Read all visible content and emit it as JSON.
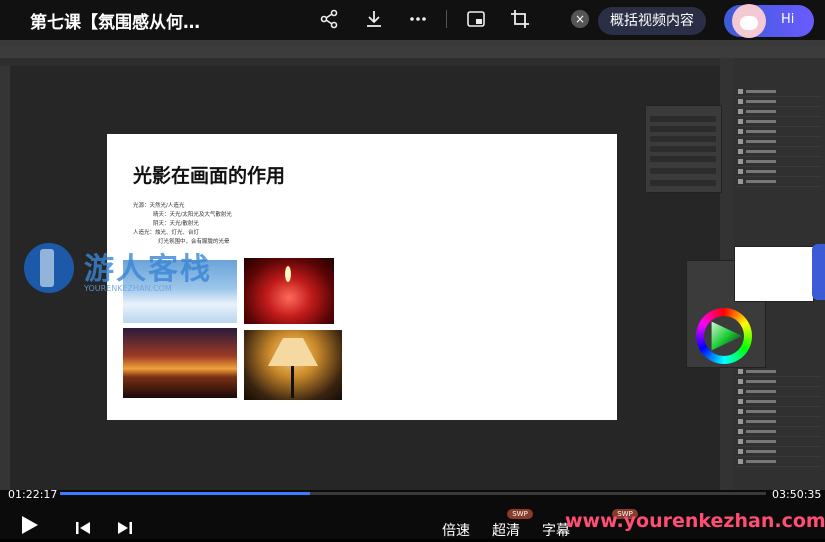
{
  "video": {
    "title": "第七课【氛围感从何…",
    "summary_button": "概括视频内容",
    "assistant_label": "Hi",
    "current_time": "01:22:17",
    "duration": "03:50:35",
    "progress_fraction": 0.354,
    "speed_label": "倍速",
    "quality_label": "超清",
    "subtitle_label": "字幕",
    "badge_1": "SWP",
    "badge_2": "SWP"
  },
  "slide": {
    "title": "光影在画面的作用",
    "lines": [
      "光源：天然光/人造光",
      "晴天：天光/太阳光及大气散射光",
      "阴天：天光/散射光",
      "人造光：烛光、灯光、台灯",
      "灯光氛围中，会有朦胧的光晕"
    ]
  },
  "watermark": {
    "brand": "游人客栈",
    "sub": "YOURENKEZHAN.COM",
    "url": "www.yourenkezhan.com"
  },
  "icons": {
    "share": "share-icon",
    "download": "download-icon",
    "more": "more-icon",
    "pip": "pip-icon",
    "crop": "crop-icon",
    "play": "play-icon",
    "prev": "prev-icon",
    "next": "next-icon",
    "close": "close-icon"
  },
  "colors": {
    "accent": "#3d5bd6",
    "progress": "#3d7bff",
    "watermark_url": "#ff4d73"
  }
}
